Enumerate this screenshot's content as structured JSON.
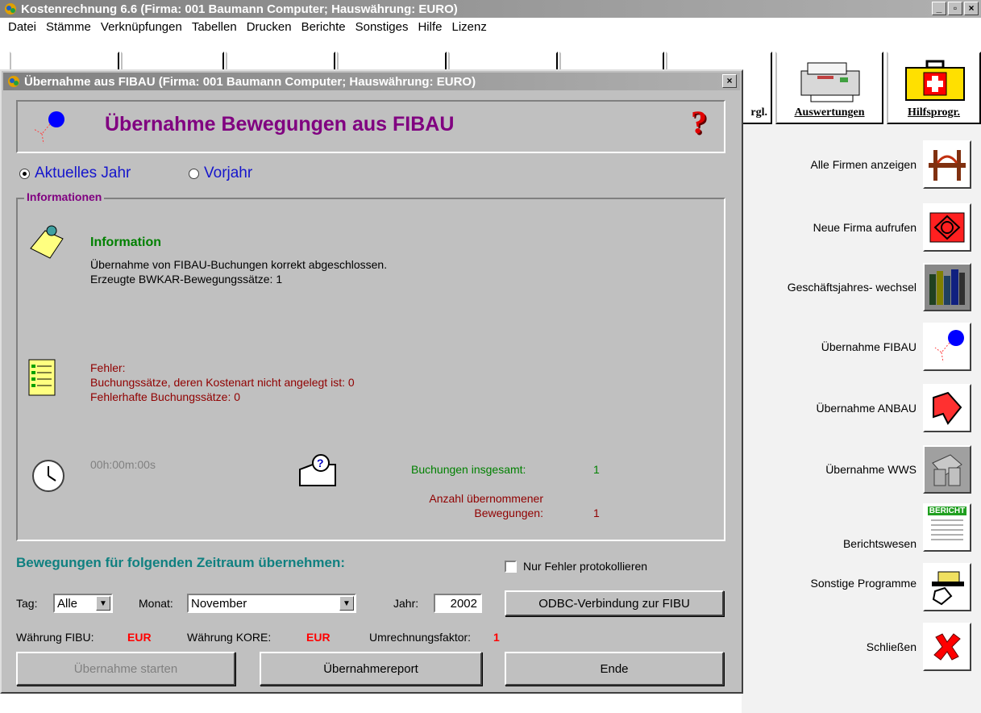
{
  "app": {
    "title": "Kostenrechnung 6.6  (Firma: 001 Baumann Computer;   Hauswährung: EURO)",
    "min": "_",
    "max": "▫",
    "close": "×"
  },
  "menu": [
    "Datei",
    "Stämme",
    "Verknüpfungen",
    "Tabellen",
    "Drucken",
    "Berichte",
    "Sonstiges",
    "Hilfe",
    "Lizenz"
  ],
  "toolbar": {
    "partial_label": "rgl.",
    "auswertungen": "Auswertungen",
    "hilfsprogr": "Hilfsprogr."
  },
  "sidebar": [
    {
      "label": "Alle Firmen anzeigen",
      "icon": "bridge-icon"
    },
    {
      "label": "Neue Firma aufrufen",
      "icon": "red-diamond-icon"
    },
    {
      "label": "Geschäftsjahres- wechsel",
      "icon": "books-icon"
    },
    {
      "label": "Übernahme FIBAU",
      "icon": "balloon-icon"
    },
    {
      "label": "Übernahme ANBAU",
      "icon": "arrow-icon"
    },
    {
      "label": "Übernahme WWS",
      "icon": "folders-icon"
    },
    {
      "label": "Berichtswesen",
      "icon": "report-icon"
    },
    {
      "label": "Sonstige Programme",
      "icon": "hand-printer-icon"
    },
    {
      "label": "Schließen",
      "icon": "red-x-icon"
    }
  ],
  "sidebar_report_text": "BERICHT",
  "dialog": {
    "title": "Übernahme aus FIBAU  (Firma: 001 Baumann Computer;   Hauswährung: EURO)",
    "close": "×",
    "header": "Übernahme Bewegungen aus FIBAU",
    "help": "?",
    "radio_current": "Aktuelles Jahr",
    "radio_prev": "Vorjahr",
    "group_label": "Informationen",
    "info_title": "Information",
    "info_line1": "Übernahme von FIBAU-Buchungen korrekt abgeschlossen.",
    "info_line2": "Erzeugte BWKAR-Bewegungssätze: 1",
    "err_title": "Fehler:",
    "err_line1": "Buchungssätze, deren Kostenart nicht angelegt ist: 0",
    "err_line2": "Fehlerhafte Buchungssätze: 0",
    "time": "00h:00m:00s",
    "total_label": "Buchungen insgesamt:",
    "total_value": "1",
    "moved_label1": "Anzahl übernommener",
    "moved_label2": "Bewegungen:",
    "moved_value": "1",
    "period_title": "Bewegungen für folgenden Zeitraum übernehmen:",
    "only_errors": "Nur Fehler protokollieren",
    "day_label": "Tag:",
    "day_value": "Alle",
    "month_label": "Monat:",
    "month_value": "November",
    "year_label": "Jahr:",
    "year_value": "2002",
    "odbc": "ODBC-Verbindung zur FIBU",
    "cur_fibu_label": "Währung FIBU:",
    "cur_fibu": "EUR",
    "cur_kore_label": "Währung KORE:",
    "cur_kore": "EUR",
    "factor_label": "Umrechnungsfaktor:",
    "factor": "1",
    "btn_start": "Übernahme starten",
    "btn_report": "Übernahmereport",
    "btn_end": "Ende"
  }
}
